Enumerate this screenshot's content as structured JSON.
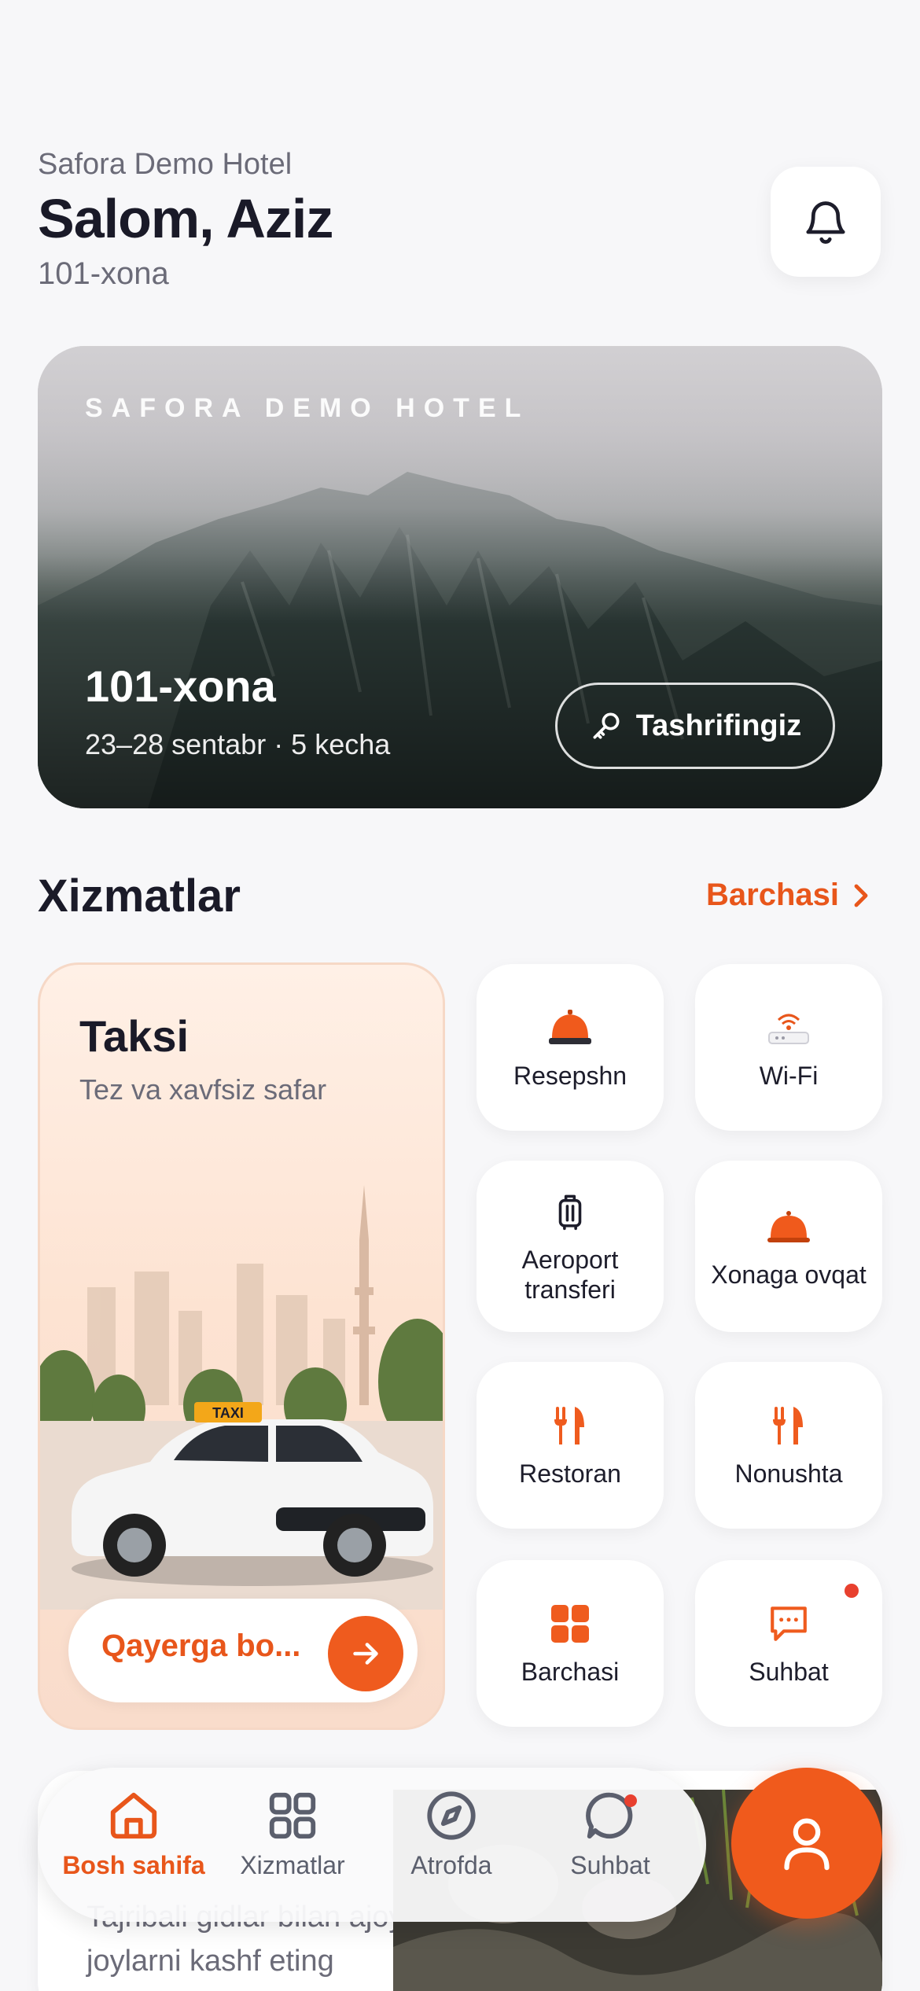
{
  "header": {
    "hotel_name": "Safora Demo Hotel",
    "greeting": "Salom, Aziz",
    "room": "101-xona"
  },
  "hero": {
    "brand": "SAFORA DEMO HOTEL",
    "room": "101-xona",
    "dates": "23–28 sentabr · 5 kecha",
    "visit_button": "Tashrifingiz"
  },
  "services": {
    "title": "Xizmatlar",
    "see_all": "Barchasi",
    "taxi": {
      "title": "Taksi",
      "subtitle": "Tez va xavfsiz safar",
      "sign": "TAXI",
      "cta_placeholder": "Qayerga bo..."
    },
    "tiles": [
      {
        "label": "Resepshn",
        "icon": "reception-bell-icon"
      },
      {
        "label": "Wi-Fi",
        "icon": "wifi-router-icon"
      },
      {
        "label": "Aeroport transferi",
        "icon": "luggage-icon"
      },
      {
        "label": "Xonaga ovqat",
        "icon": "room-service-icon"
      },
      {
        "label": "Restoran",
        "icon": "fork-knife-icon"
      },
      {
        "label": "Nonushta",
        "icon": "fork-knife-icon"
      },
      {
        "label": "Barchasi",
        "icon": "grid-icon"
      },
      {
        "label": "Suhbat",
        "icon": "chat-icon"
      }
    ]
  },
  "peek": {
    "text": "Tajribali gidlar bilan ajoyib joylarni kashf eting"
  },
  "nav": {
    "items": [
      {
        "label": "Bosh sahifa",
        "icon": "home-icon"
      },
      {
        "label": "Xizmatlar",
        "icon": "grid-icon"
      },
      {
        "label": "Atrofda",
        "icon": "compass-icon"
      },
      {
        "label": "Suhbat",
        "icon": "chat-icon"
      }
    ]
  },
  "colors": {
    "accent": "#e8561b",
    "fab": "#f05a1c",
    "background": "#f7f7f9"
  }
}
